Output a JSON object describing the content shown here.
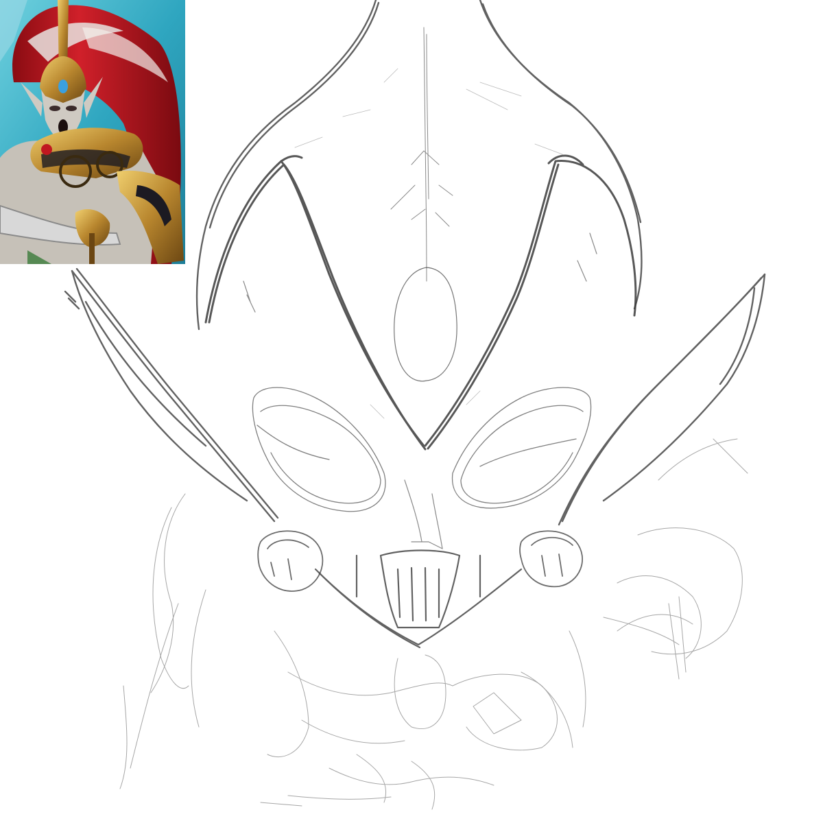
{
  "image": {
    "background_color": "#ffffff",
    "sketch_stroke_color": "#3a3a3a",
    "reference_colors": {
      "backdrop": "#2fa6c0",
      "hair_red": "#b3121b",
      "hair_white": "#e8e4e0",
      "armor_gold": "#b8862e",
      "armor_dark": "#1c1a22",
      "skin_pale": "#cfcac2",
      "gem_blue": "#3aa0e0",
      "gem_red": "#c01820"
    }
  }
}
